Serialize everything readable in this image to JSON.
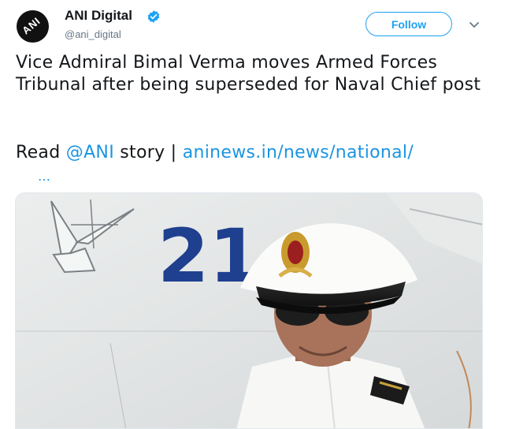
{
  "account": {
    "name": "ANI Digital",
    "handle": "@ani_digital",
    "verified": true,
    "avatar_logo_text": "ANI"
  },
  "actions": {
    "follow_label": "Follow",
    "menu_icon": "chevron-down-icon"
  },
  "tweet": {
    "text": "Vice Admiral Bimal Verma moves Armed Forces Tribunal after being superseded for Naval Chief post",
    "read_prefix": "Read ",
    "mention": "@ANI",
    "story_sep": " story | ",
    "link": "aninews.in/news/national/",
    "link_ellipsis": "…"
  },
  "media": {
    "aircraft_number": "21",
    "description_icon": "photo"
  },
  "colors": {
    "accent": "#1da1f2",
    "link": "#1b95e0",
    "text": "#14171a",
    "muted": "#657786"
  }
}
